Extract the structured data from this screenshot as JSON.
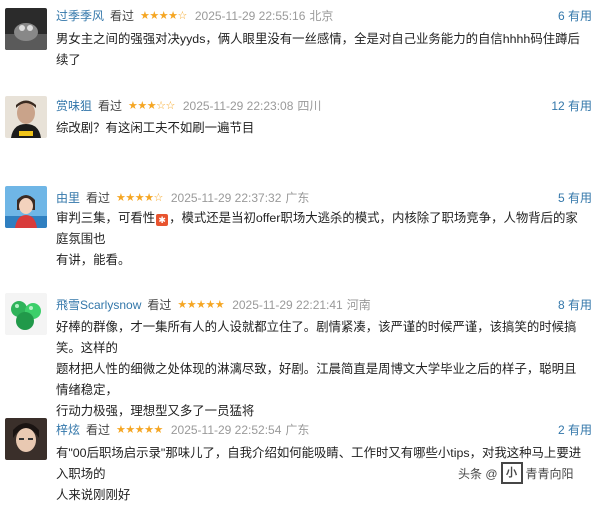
{
  "reviews": [
    {
      "user": "过季季风",
      "watched": "看过",
      "stars": "★★★★☆",
      "rating": 4,
      "time": "2025-11-29 22:55:16",
      "location": "北京",
      "useful": "6 有用",
      "lines": [
        "男女主之间的强强对决yyds，俩人眼里没有一丝感情，全是对自己业务能力的自信hhhh码住蹲后续了"
      ]
    },
    {
      "user": "赏味狙",
      "watched": "看过",
      "stars": "★★★☆☆",
      "rating": 3,
      "time": "2025-11-29 22:23:08",
      "location": "四川",
      "useful": "12 有用",
      "lines": [
        "综改剧？有这闲工夫不如刷一遍节目"
      ]
    },
    {
      "user": "由里",
      "watched": "看过",
      "stars": "★★★★☆",
      "rating": 4,
      "time": "2025-11-29 22:37:32",
      "location": "广东",
      "useful": "5 有用",
      "line1_a": "审判三集，可看性",
      "line1_b": "，模式还是当初offer职场大逃杀的模式，内核除了职场竞争，人物背后的家庭氛围也",
      "line2": "有讲，能看。"
    },
    {
      "user": "飛雪Scarlysnow",
      "watched": "看过",
      "stars": "★★★★★",
      "rating": 5,
      "time": "2025-11-29 22:21:41",
      "location": "河南",
      "useful": "8 有用",
      "lines": [
        "好棒的群像，才一集所有人的人设就都立住了。剧情紧凑，该严谨的时候严谨，该搞笑的时候搞笑。这样的",
        "题材把人性的细微之处体现的淋漓尽致，好剧。江晨简直是周博文大学毕业之后的样子，聪明且情绪稳定，",
        "行动力极强，理想型又多了一员猛将"
      ]
    },
    {
      "user": "梓炫",
      "watched": "看过",
      "stars": "★★★★★",
      "rating": 5,
      "time": "2025-11-29 22:52:54",
      "location": "广东",
      "useful": "2 有用",
      "lines": [
        "有\"00后职场启示录\"那味儿了，自我介绍如何能吸睛、工作时又有哪些小tips，对我这种马上要进入职场的",
        "人来说刚刚好"
      ]
    }
  ],
  "watermark": {
    "text_left": "头条 @",
    "logo_char": "小",
    "text_right": "青青向阳"
  }
}
